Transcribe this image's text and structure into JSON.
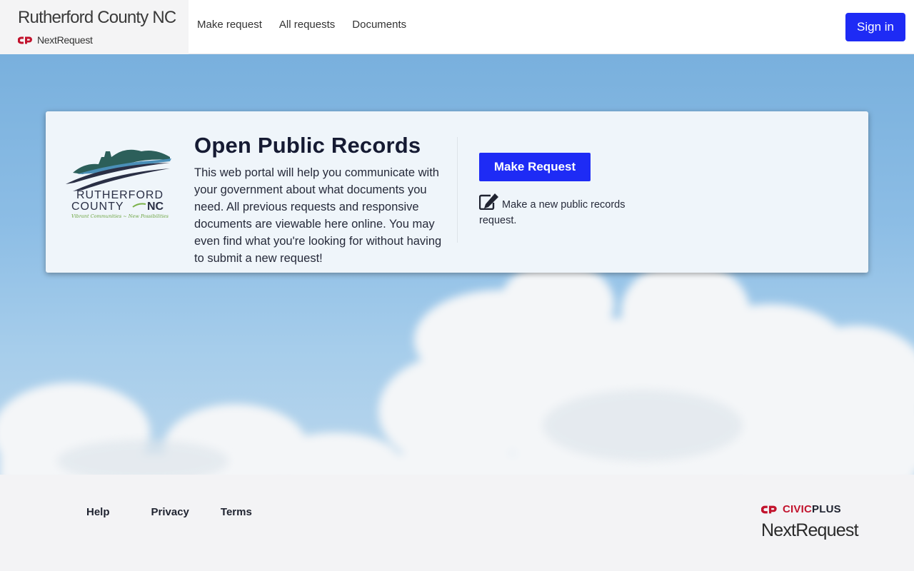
{
  "header": {
    "site_title": "Rutherford County NC",
    "product_name": "NextRequest",
    "nav": [
      {
        "label": "Make request"
      },
      {
        "label": "All requests"
      },
      {
        "label": "Documents"
      }
    ],
    "sign_in_label": "Sign in"
  },
  "card": {
    "logo": {
      "line1": "RUTHERFORD",
      "line2": "COUNTY",
      "line2_suffix": "NC",
      "tagline": "Vibrant Communities ~ New Possibilities"
    },
    "title": "Open Public Records",
    "body": "This web portal will help you communicate with your government about what documents you need. All previous requests and responsive documents are viewable here online. You may even find what you're looking for without having to submit a new request!",
    "make_request_label": "Make Request",
    "new_request_text": "Make a new public records request."
  },
  "footer": {
    "links": [
      {
        "label": "Help"
      },
      {
        "label": "Privacy"
      },
      {
        "label": "Terms"
      }
    ],
    "brand_civic": "CIVIC",
    "brand_plus": "PLUS",
    "brand_product": "NextRequest"
  },
  "colors": {
    "primary_button": "#1e2bf5",
    "brand_red": "#c2132d",
    "sky": "#79b0dd"
  },
  "icons": {
    "civicplus_mark": "cp-logo-icon",
    "edit": "edit-icon"
  }
}
